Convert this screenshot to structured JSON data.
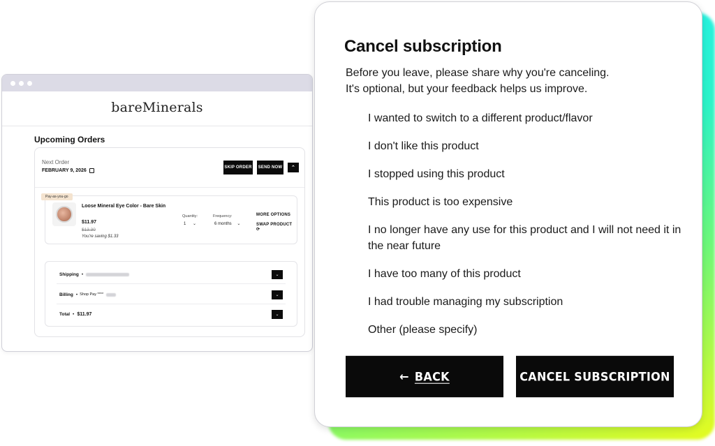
{
  "browser": {
    "brand": "bareMinerals",
    "section_title": "Upcoming Orders",
    "next_order_label": "Next Order",
    "next_order_date": "FEBRUARY 9, 2026",
    "skip_order": "SKIP ORDER",
    "send_now": "SEND NOW",
    "product": {
      "badge": "Pay-as-you-go",
      "name": "Loose Mineral Eye Color - Bare Skin",
      "price": "$11.97",
      "old_price": "$13.30",
      "saving": "You're saving $1.33",
      "quantity_label": "Quantity:",
      "quantity_value": "1",
      "frequency_label": "Frequency:",
      "frequency_value": "6 months",
      "more_options": "MORE OPTIONS",
      "swap_product": "SWAP PRODUCT"
    },
    "summary": {
      "shipping_label": "Shipping",
      "billing_label": "Billing",
      "billing_value": "Shop Pay ****",
      "total_label": "Total",
      "total_value": "$11.97"
    }
  },
  "modal": {
    "title": "Cancel subscription",
    "intro_line1": "Before you leave, please share why you're canceling.",
    "intro_line2": "It's optional, but your feedback helps us improve.",
    "reasons": [
      "I wanted to switch to a different product/flavor",
      "I don't like this product",
      "I stopped using this product",
      "This product is too expensive",
      "I no longer have any use for this product and I will not need it in the near future",
      "I have too many of this product",
      "I had trouble managing my subscription",
      "Other (please specify)"
    ],
    "back_label": "BACK",
    "cancel_label": "CANCEL SUBSCRIPTION"
  }
}
